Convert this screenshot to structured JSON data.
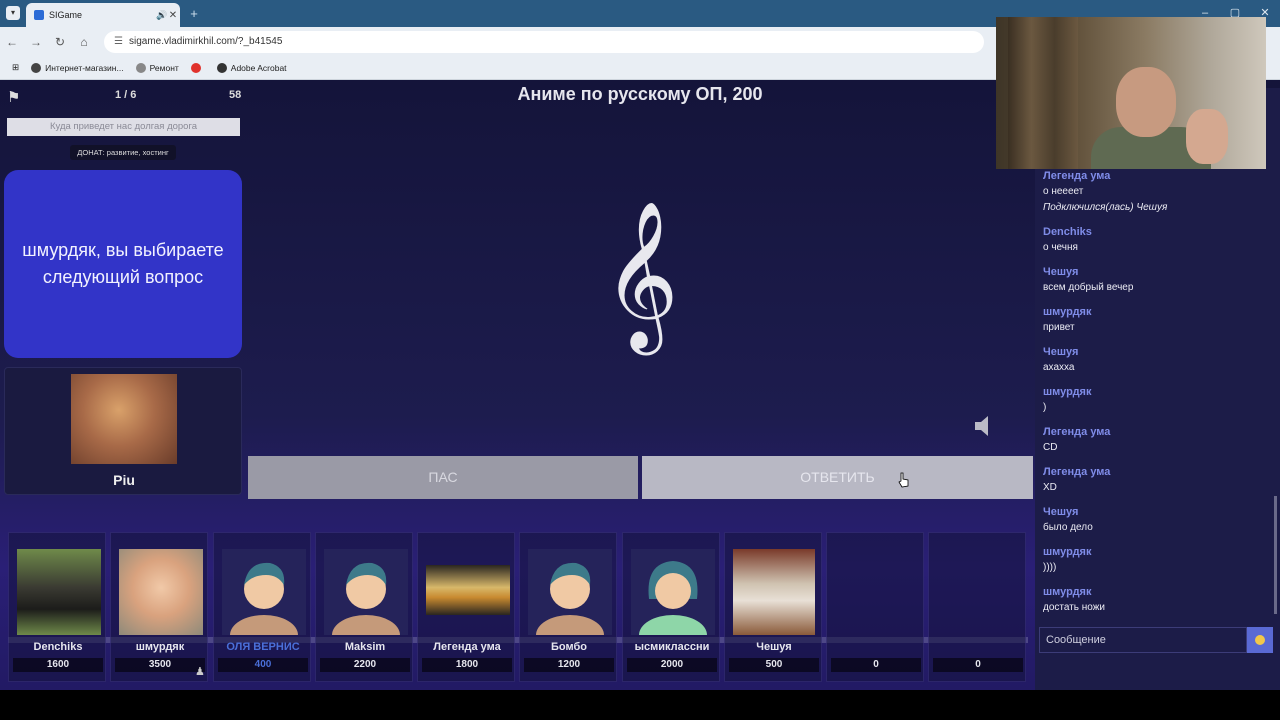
{
  "browser": {
    "tab_title": "SIGame",
    "url": "sigame.vladimirkhil.com/?_b41545",
    "bookmarks": [
      "Интернет-магазин...",
      "Ремонт",
      "Adobe Acrobat"
    ]
  },
  "game": {
    "round_counter": "1 / 6",
    "timer": "58",
    "question_title": "Аниме по русскому ОП, 200",
    "round_name_placeholder": "Куда приведет нас долгая дорога",
    "donate_label": "ДОНАТ: развитие, хостинг",
    "prompt": "шмурдяк, вы выбираете следующий вопрос",
    "showman_name": "Piu",
    "pass_label": "ПАС",
    "answer_label": "ОТВЕТИТЬ",
    "media_icon": "treble-clef-icon"
  },
  "players": [
    {
      "name": "Denchiks",
      "score": "1600",
      "active": false
    },
    {
      "name": "шмурдяк",
      "score": "3500",
      "active": false
    },
    {
      "name": "ОЛЯ ВЕРНИС",
      "score": "400",
      "active": true
    },
    {
      "name": "Maksim",
      "score": "2200",
      "active": false
    },
    {
      "name": "Легенда ума",
      "score": "1800",
      "active": false
    },
    {
      "name": "Бомбо",
      "score": "1200",
      "active": false
    },
    {
      "name": "ысмиклассни",
      "score": "2000",
      "active": false
    },
    {
      "name": "Чешуя",
      "score": "500",
      "active": false
    },
    {
      "name": "",
      "score": "0",
      "active": false
    },
    {
      "name": "",
      "score": "0",
      "active": false
    }
  ],
  "chat": {
    "messages": [
      {
        "who": "Легенда ума",
        "text": "о нееeет",
        "system": "Подключился(лась) Чешуя"
      },
      {
        "who": "Denchiks",
        "text": "о чечня"
      },
      {
        "who": "Чешуя",
        "text": "всем добрый вечер"
      },
      {
        "who": "шмурдяк",
        "text": "привет"
      },
      {
        "who": "Чешуя",
        "text": "ахахха"
      },
      {
        "who": "шмурдяк",
        "text": ")"
      },
      {
        "who": "Легенда ума",
        "text": "CD"
      },
      {
        "who": "Легенда ума",
        "text": "XD"
      },
      {
        "who": "Чешуя",
        "text": "было дело"
      },
      {
        "who": "шмурдяк",
        "text": "))))"
      },
      {
        "who": "шмурдяк",
        "text": "достать ножи"
      }
    ],
    "input_placeholder": "Сообщение"
  },
  "colors": {
    "prompt_bg": "#3234c8",
    "chat_name": "#7f8ce8",
    "active_player": "#4a6fd8"
  }
}
